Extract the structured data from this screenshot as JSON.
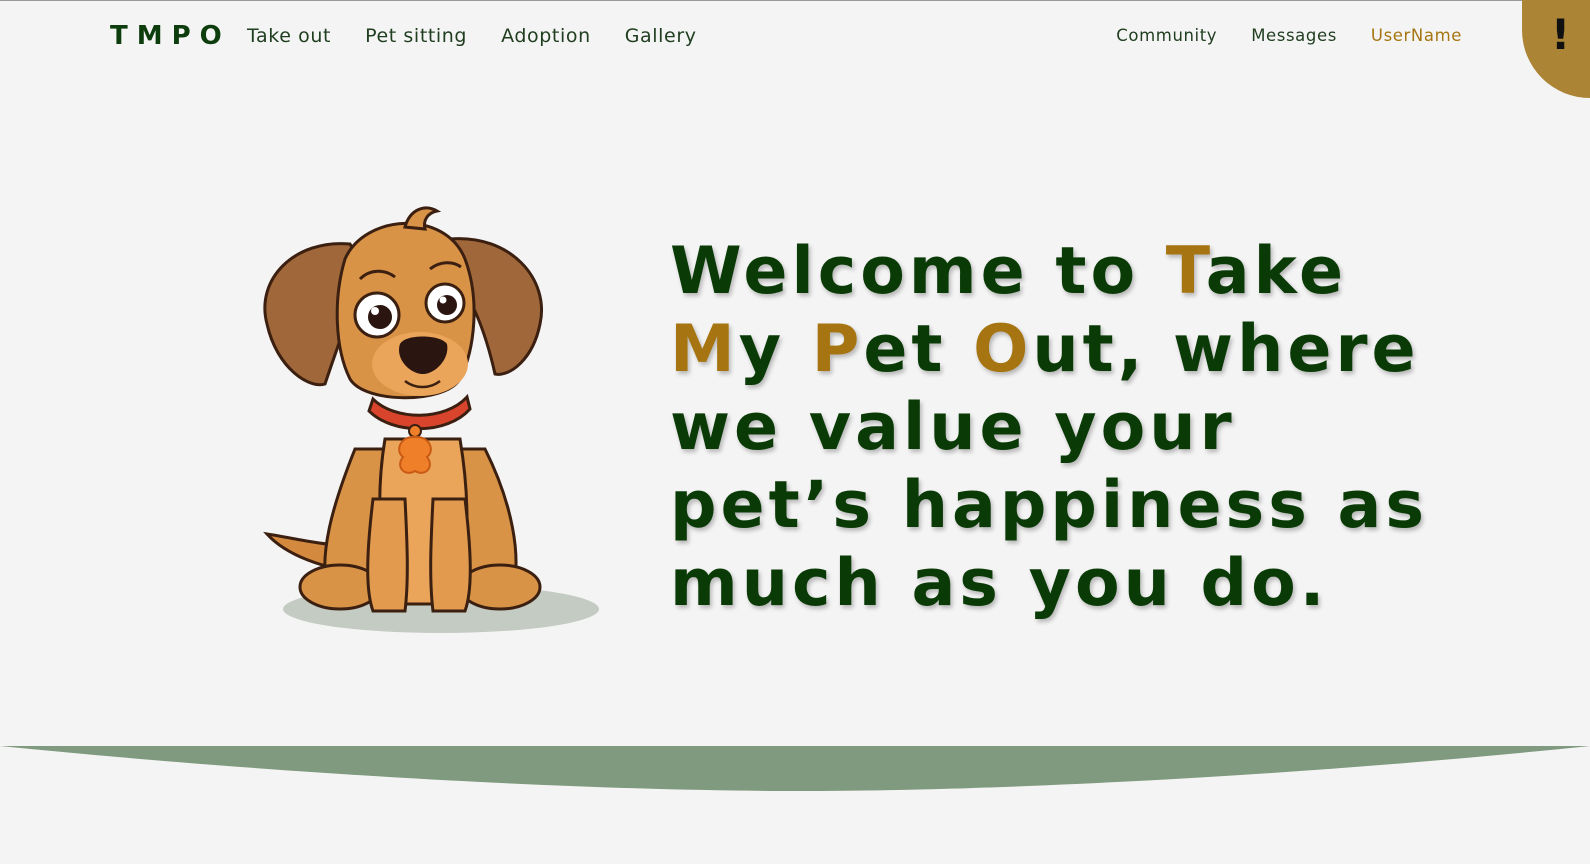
{
  "brand": {
    "logo": "TMPO"
  },
  "nav": {
    "left": [
      "Take out",
      "Pet sitting",
      "Adoption",
      "Gallery"
    ],
    "right": {
      "community": "Community",
      "messages": "Messages",
      "username": "UserName"
    }
  },
  "alert": {
    "symbol": "!"
  },
  "hero": {
    "segments": [
      {
        "text": "Welcome to "
      },
      {
        "text": "T",
        "accent": true
      },
      {
        "text": "ake "
      },
      {
        "text": "M",
        "accent": true
      },
      {
        "text": "y "
      },
      {
        "text": "P",
        "accent": true
      },
      {
        "text": "et "
      },
      {
        "text": "O",
        "accent": true
      },
      {
        "text": "ut, where we value your pet’s happiness as much as you do."
      }
    ]
  },
  "colors": {
    "primary_green": "#0a3b07",
    "accent_gold": "#a67511",
    "wave_green": "#7f9a7e",
    "background": "#f4f4f4"
  }
}
